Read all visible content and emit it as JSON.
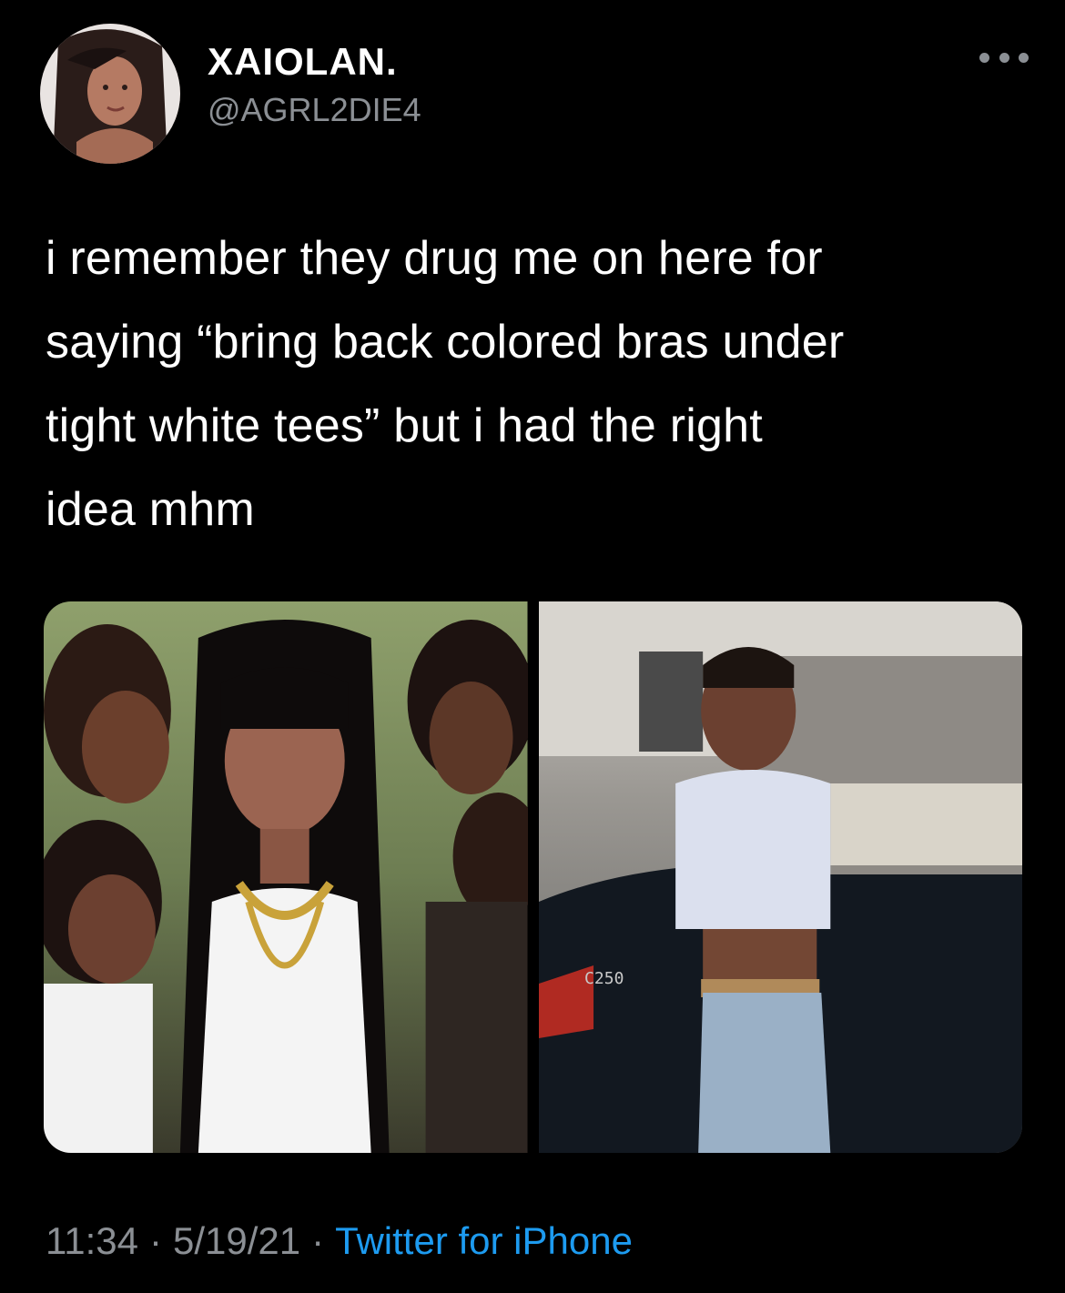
{
  "user": {
    "display_name": "XAIOLAN.",
    "handle": "@AGRL2DIE4",
    "avatar_icon": "profile-photo"
  },
  "tweet": {
    "lines": [
      "i remember they drug me on here for",
      "saying “bring back colored bras under",
      "tight white tees” but i had the right",
      "idea mhm"
    ]
  },
  "media": {
    "photos": [
      {
        "icon": "group-photo",
        "label": ""
      },
      {
        "icon": "car-photo",
        "label": "C250"
      }
    ]
  },
  "footer": {
    "time": "11:34",
    "separator": "·",
    "date": "5/19/21",
    "source": "Twitter for iPhone"
  },
  "colors": {
    "background": "#000000",
    "text": "#ffffff",
    "secondary": "#8b8f94",
    "link": "#1d9bf0"
  }
}
